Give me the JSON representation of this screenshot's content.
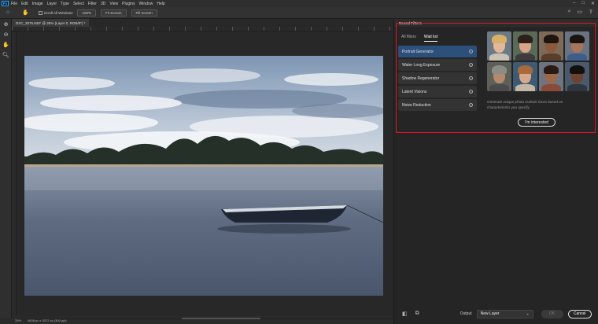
{
  "menubar": {
    "logo": "Ps",
    "items": [
      "File",
      "Edit",
      "Image",
      "Layer",
      "Type",
      "Select",
      "Filter",
      "3D",
      "View",
      "Plugins",
      "Window",
      "Help"
    ]
  },
  "optionsbar": {
    "scroll_all_windows": "Scroll All Windows",
    "zoom_value": "100%",
    "fit_screen": "Fit Screen",
    "fill_screen": "Fill Screen"
  },
  "document": {
    "tab_label": "DSC_3076.NEF @ 25% (Layer 0, RGB/8*) *"
  },
  "status": {
    "zoom": "25%",
    "info": "4608 px x 3072 px (300 ppi)"
  },
  "neural_filters": {
    "title": "Neural Filters",
    "tabs": [
      "All filters",
      "Wait list"
    ],
    "active_tab": "Wait list",
    "filters": [
      {
        "label": "Portrait Generator",
        "selected": true
      },
      {
        "label": "Water Long Exposure",
        "selected": false
      },
      {
        "label": "Shadow Regenerator",
        "selected": false
      },
      {
        "label": "Latent Visions",
        "selected": false
      },
      {
        "label": "Noise Reduction",
        "selected": false
      }
    ],
    "description": "Generate unique photo realistic faces based on characteristics you specify.",
    "interest_button": "I'm interested",
    "output_label": "Output",
    "output_value": "New Layer",
    "ok_label": "OK",
    "cancel_label": "Cancel"
  },
  "colors": {
    "highlight": "#e0141e",
    "selected_item": "#2d4f7c"
  }
}
